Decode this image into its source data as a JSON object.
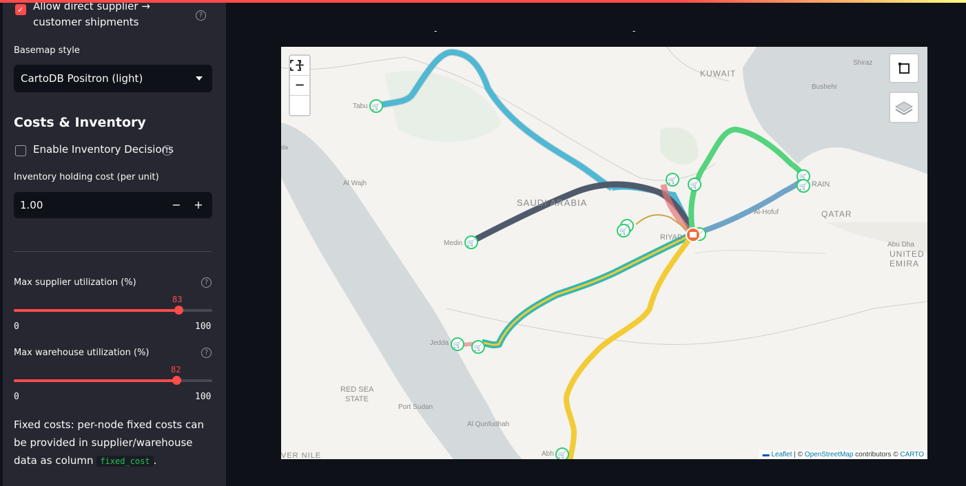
{
  "sidebar": {
    "allow_direct": {
      "label": "Allow direct supplier → customer shipments",
      "checked": true
    },
    "basemap": {
      "label": "Basemap style",
      "value": "CartoDB Positron (light)"
    },
    "section_title": "Costs & Inventory",
    "inventory_toggle": {
      "label": "Enable Inventory Decisions",
      "checked": false
    },
    "holding_cost": {
      "label": "Inventory holding cost (per unit)",
      "value": "1.00",
      "minus": "−",
      "plus": "+"
    },
    "supplier_util": {
      "label": "Max supplier utilization (%)",
      "value": "83",
      "value_num": 83,
      "min": "0",
      "max": "100"
    },
    "warehouse_util": {
      "label": "Max warehouse utilization (%)",
      "value": "82",
      "value_num": 82,
      "min": "0",
      "max": "100"
    },
    "fixed_costs": {
      "text": "Fixed costs: per-node fixed costs can be provided in supplier/warehouse data as column",
      "code": "fixed_cost",
      "end": "."
    }
  },
  "map": {
    "zoom_in": "+",
    "zoom_out": "−",
    "fullscreen_icon": "fullscreen-icon",
    "draw_icon": "draw-rectangle-icon",
    "layers_icon": "layers-icon",
    "attribution": {
      "leaflet": "Leaflet",
      "sep": " | © ",
      "osm": "OpenStreetMap",
      "contrib": " contributors © ",
      "carto": "CARTO"
    },
    "labels": {
      "kuwait": "KUWAIT",
      "shiraz": "Shiraz",
      "bushehr": "Bushehr",
      "tabuk": "Tabu",
      "alwajh": "Al Wajh",
      "saudi": "SAUDI ARABIA",
      "medina": "Medin",
      "riyadh": "RIYAD",
      "alhofuf": "Al-Hofuf",
      "qatar": "QATAR",
      "bahrain": "RAIN",
      "abudhabi": "Abu Dha",
      "uae1": "UNITED",
      "uae2": "EMIRA",
      "jeddah": "Jedda",
      "redsea1": "RED SEA",
      "redsea2": "STATE",
      "portsudan": "Port Sudan",
      "alqunfudhah": "Al Qunfudhah",
      "abha": "Abh",
      "nile": "VER NILE",
      "da": "da"
    }
  },
  "colors": {
    "accent": "#ff4b4b",
    "blue_route": "#4fb8d4",
    "dark_route": "#4f5a6b",
    "teal_route": "#36b7ad",
    "yellow_route": "#f2cb37",
    "green_route": "#55d37e",
    "marker": "#2ecc71",
    "warehouse": "#f26b3a"
  }
}
